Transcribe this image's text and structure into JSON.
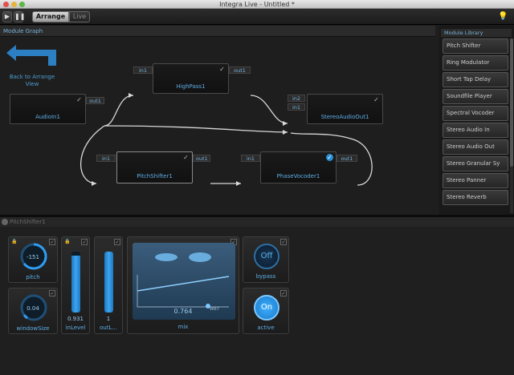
{
  "window": {
    "title": "Integra Live - Untitled *"
  },
  "toolbar": {
    "play_icon": "play-icon",
    "pause_icon": "pause-icon",
    "arrange_label": "Arrange",
    "live_label": "Live",
    "lightbulb_icon": "lightbulb-icon"
  },
  "graph": {
    "header": "Module Graph",
    "back_label": "Back to Arrange View",
    "modules": {
      "audioin": {
        "name": "AudioIn1",
        "out": "out1"
      },
      "highpass": {
        "name": "HighPass1",
        "in": "in1",
        "out": "out1"
      },
      "stereo": {
        "name": "StereoAudioOut1",
        "in2": "in2",
        "in1": "in1"
      },
      "pitch": {
        "name": "PitchShifter1",
        "in": "in1",
        "out": "out1"
      },
      "phase": {
        "name": "PhaseVocoder1",
        "in": "in1",
        "out": "out1"
      }
    }
  },
  "library": {
    "header": "Module Library",
    "items": [
      "Pitch Shifter",
      "Ring Modulator",
      "Short Tap Delay",
      "Soundfile Player",
      "Spectral Vocoder",
      "Stereo Audio In",
      "Stereo Audio Out",
      "Stereo Granular Sy",
      "Stereo Panner",
      "Stereo Reverb"
    ]
  },
  "props": {
    "header": "PitchShifter1",
    "pitch": {
      "value": "-151",
      "label": "pitch"
    },
    "windowSize": {
      "value": "0.04",
      "label": "windowSize"
    },
    "inLevel": {
      "value": "0.931",
      "label": "inLevel",
      "level": 0.93
    },
    "outLevel": {
      "value": "1",
      "label": "outL...",
      "level": 1.0
    },
    "mix": {
      "value": "0.764",
      "label": "mix",
      "wet_label": "WET"
    },
    "bypass": {
      "value": "Off",
      "label": "bypass"
    },
    "active": {
      "value": "On",
      "label": "active"
    }
  },
  "colors": {
    "accent": "#2a8fd6",
    "text_blue": "#5eaee6"
  }
}
